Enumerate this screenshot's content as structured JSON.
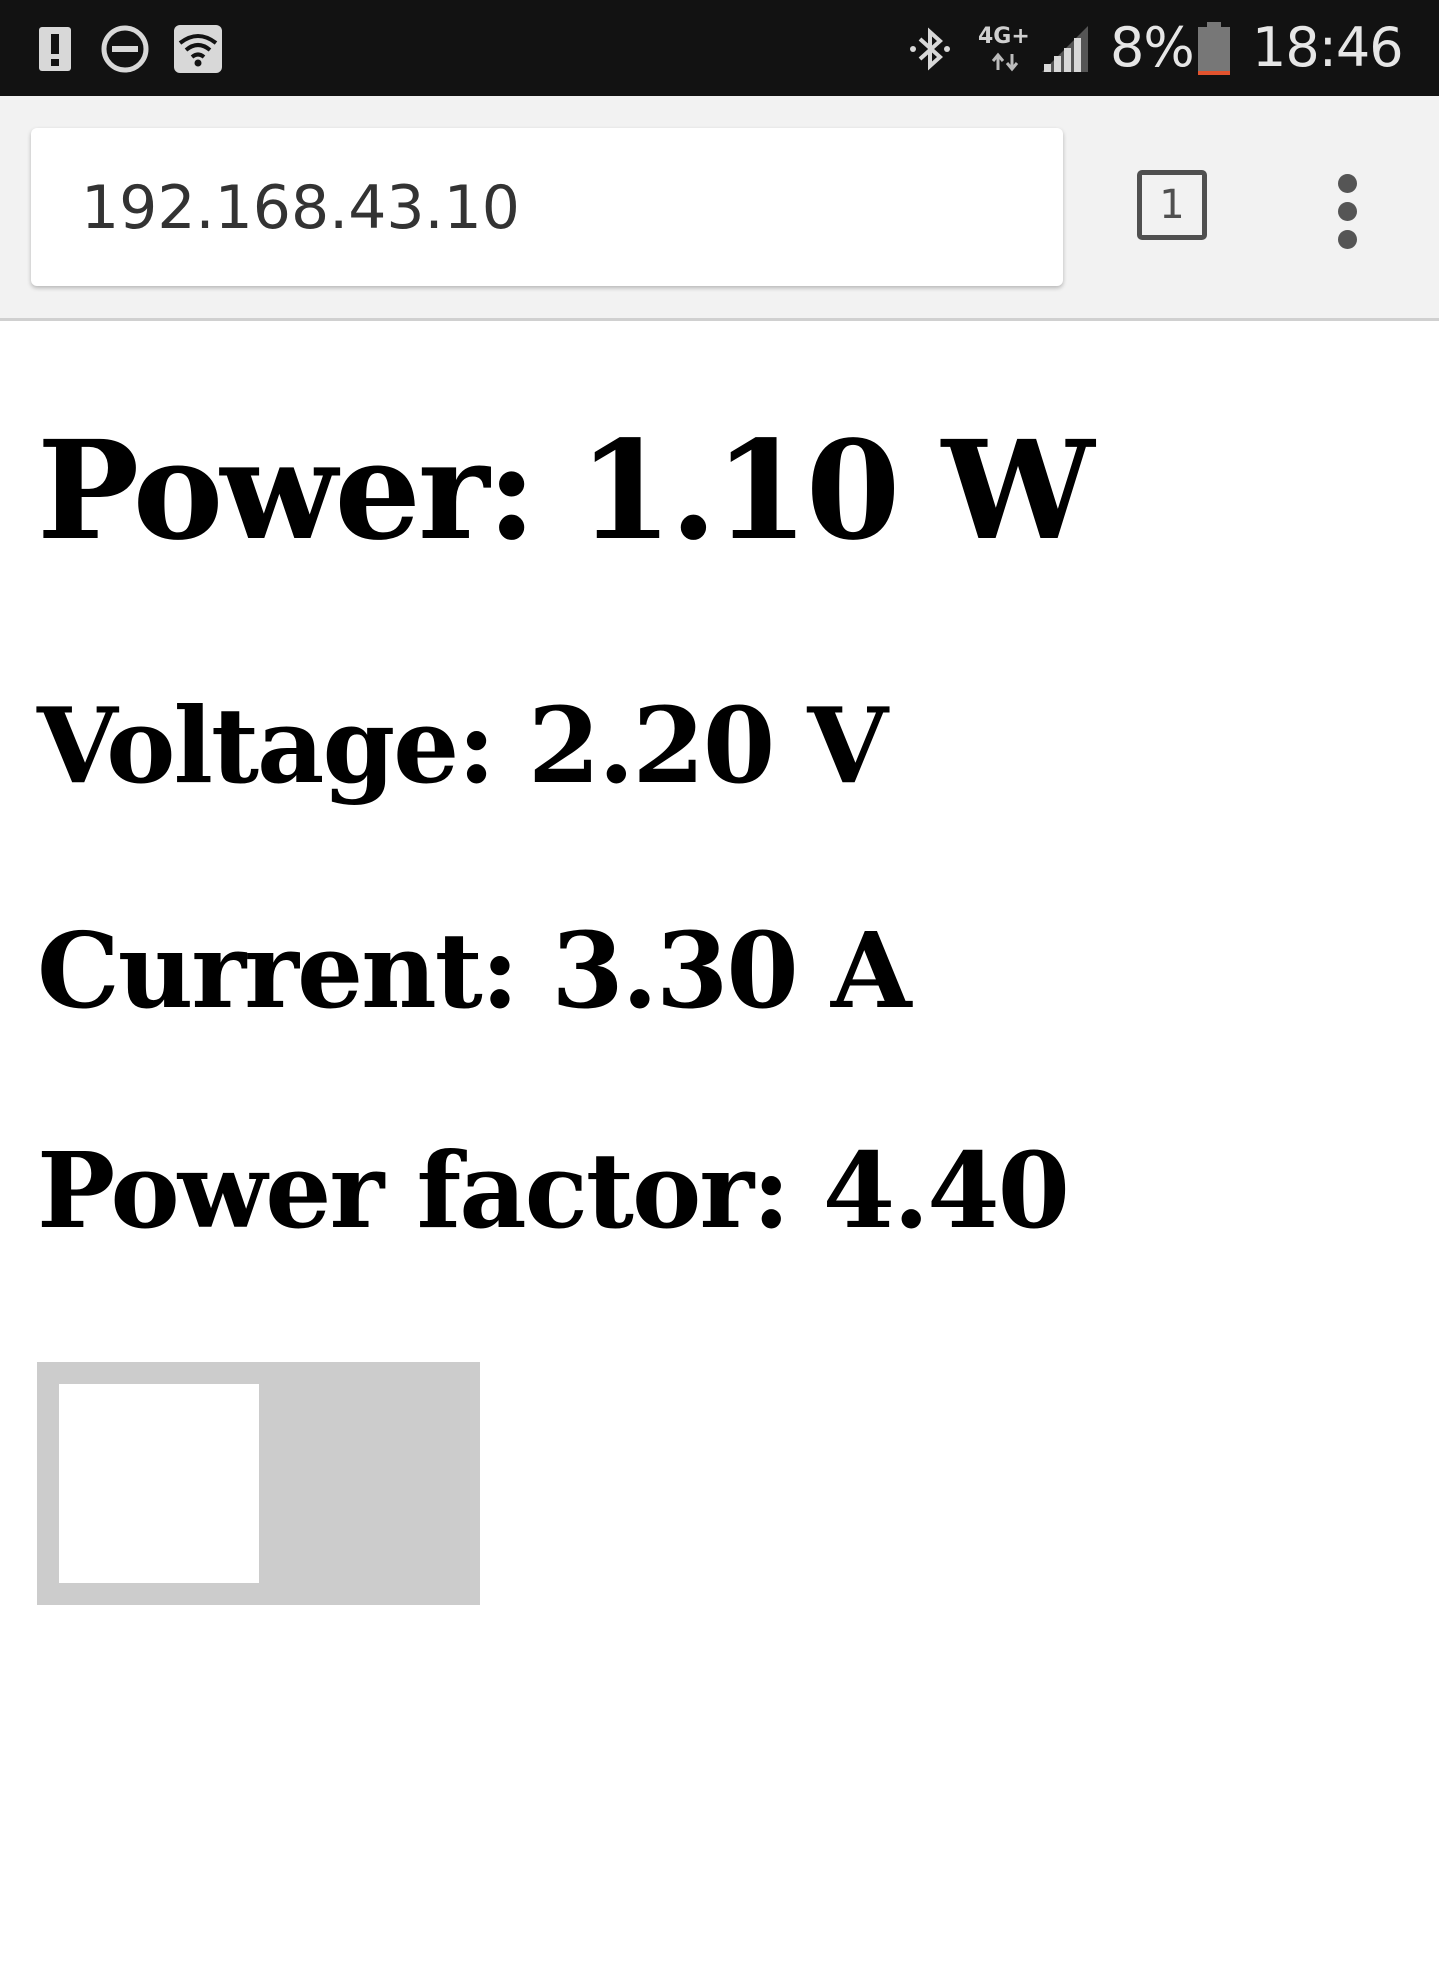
{
  "status_bar": {
    "network_type": "4G+",
    "battery_percent": "8%",
    "time": "18:46",
    "battery_level": 0.08,
    "icons": [
      "alert-icon",
      "do-not-disturb-icon",
      "wifi-icon",
      "bluetooth-icon",
      "data-arrows-icon",
      "signal-icon",
      "battery-icon"
    ]
  },
  "browser": {
    "url": "192.168.43.10",
    "tab_count": "1",
    "menu_icon": "overflow-menu-icon"
  },
  "readings": {
    "power": "Power: 1.10 W",
    "voltage": "Voltage: 2.20 V",
    "current": "Current: 3.30 A",
    "power_factor": "Power factor: 4.40"
  },
  "toggle": {
    "state": "off"
  },
  "colors": {
    "status_bar_bg": "#121212",
    "browser_bar_bg": "#f2f2f2",
    "toggle_track": "#cccccc",
    "toggle_knob": "#ffffff",
    "battery_low": "#e2532e"
  }
}
